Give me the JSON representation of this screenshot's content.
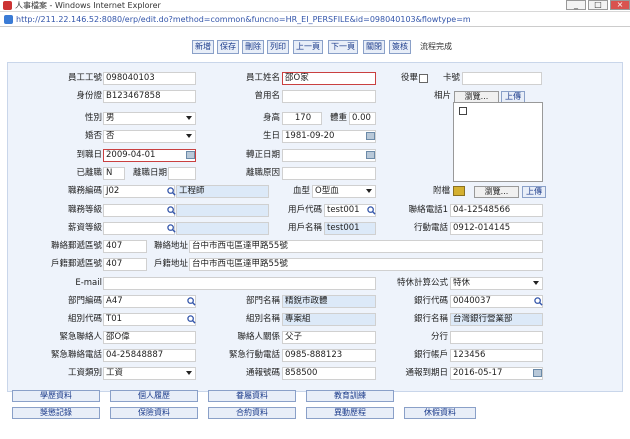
{
  "window": {
    "title": "人事檔案 - Windows Internet Explorer",
    "controls": [
      "_",
      "□",
      "×"
    ]
  },
  "address": {
    "url": "http://211.22.146.52:8080/erp/edit.do?method=common&funcno=HR_EI_PERSFILE&id=098040103&flowtype=m"
  },
  "toolbar": {
    "buttons": [
      "新增",
      "保存",
      "刪除",
      "列印",
      "上一頁",
      "下一頁",
      "關閉",
      "簽核"
    ],
    "status": "流程完成"
  },
  "form": {
    "emp_no": {
      "label": "員工工號",
      "value": "098040103"
    },
    "emp_name": {
      "label": "員工姓名",
      "value": "邵O家"
    },
    "retired": {
      "label": "役畢"
    },
    "card_no": {
      "label": "卡號",
      "value": ""
    },
    "id_no": {
      "label": "身份證",
      "value": "B123467858"
    },
    "alias": {
      "label": "曾用名",
      "value": ""
    },
    "photo": {
      "label": "相片",
      "browse": "瀏覽...",
      "upload": "上傳"
    },
    "gender": {
      "label": "性別",
      "value": "男"
    },
    "height": {
      "label": "身高",
      "value": "170"
    },
    "weight": {
      "label": "體重",
      "value": "0.00"
    },
    "married": {
      "label": "婚否",
      "value": "否"
    },
    "birthday": {
      "label": "生日",
      "value": "1981-09-20"
    },
    "hire_date": {
      "label": "到職日",
      "value": "2009-04-01"
    },
    "regular_date": {
      "label": "轉正日期",
      "value": ""
    },
    "resigned": {
      "label": "已離職",
      "value": "N"
    },
    "resign_date": {
      "label": "離職日期",
      "value": ""
    },
    "resign_reason": {
      "label": "離職原因",
      "value": ""
    },
    "job_code": {
      "label": "職務編碼",
      "value": "J02",
      "name": "工程師"
    },
    "blood": {
      "label": "血型",
      "value": "O型血"
    },
    "attachment": {
      "label": "附檔",
      "browse": "瀏覽...",
      "upload": "上傳"
    },
    "job_grade": {
      "label": "職務等級",
      "value": ""
    },
    "user_code": {
      "label": "用戶代碼",
      "value": "test001"
    },
    "phone1": {
      "label": "聯絡電話1",
      "value": "04-12548566"
    },
    "salary_grade": {
      "label": "薪資等級",
      "value": ""
    },
    "user_name": {
      "label": "用戶名稱",
      "value": "test001"
    },
    "mobile": {
      "label": "行動電話",
      "value": "0912-014145"
    },
    "contact_zip": {
      "label": "聯絡郵遞區號",
      "value": "407"
    },
    "contact_addr": {
      "label": "聯絡地址",
      "value": "台中市西屯區達甲路55號"
    },
    "reg_zip": {
      "label": "戶籍郵遞區號",
      "value": "407"
    },
    "reg_addr": {
      "label": "戶籍地址",
      "value": "台中市西屯區達甲路55號"
    },
    "email": {
      "label": "E-mail",
      "value": ""
    },
    "special_formula": {
      "label": "特休計算公式",
      "value": "特休"
    },
    "dept_code": {
      "label": "部門編碼",
      "value": "A47"
    },
    "dept_name": {
      "label": "部門名稱",
      "value": "精銳市政體"
    },
    "bank_code": {
      "label": "銀行代碼",
      "value": "0040037"
    },
    "group_code": {
      "label": "組別代碼",
      "value": "T01"
    },
    "group_name": {
      "label": "組別名稱",
      "value": "專案組"
    },
    "bank_name": {
      "label": "銀行名稱",
      "value": "台灣銀行營業部"
    },
    "emergency_contact": {
      "label": "緊急聯絡人",
      "value": "邵O偉"
    },
    "relationship": {
      "label": "聯絡人關係",
      "value": "父子"
    },
    "branch": {
      "label": "分行",
      "value": ""
    },
    "emergency_phone": {
      "label": "緊急聯絡電話",
      "value": "04-25848887"
    },
    "emergency_mobile": {
      "label": "緊急行動電話",
      "value": "0985-888123"
    },
    "bank_account": {
      "label": "銀行帳戶",
      "value": "123456"
    },
    "work_type": {
      "label": "工資類別",
      "value": "工資"
    },
    "notice_no": {
      "label": "通報號碼",
      "value": "858500"
    },
    "notice_date": {
      "label": "通報到期日",
      "value": "2016-05-17"
    }
  },
  "bottom": {
    "buttons": [
      "學歷資料",
      "個人履歷",
      "眷屬資料",
      "教育訓練",
      "獎懲記錄",
      "保險資料",
      "合約資料",
      "異動歷程",
      "休假資料"
    ]
  },
  "colors": {
    "panel": "#eef3fb",
    "readonly": "#dce9f8",
    "required_border": "#c94040",
    "button_text": "#1a3a8a"
  }
}
